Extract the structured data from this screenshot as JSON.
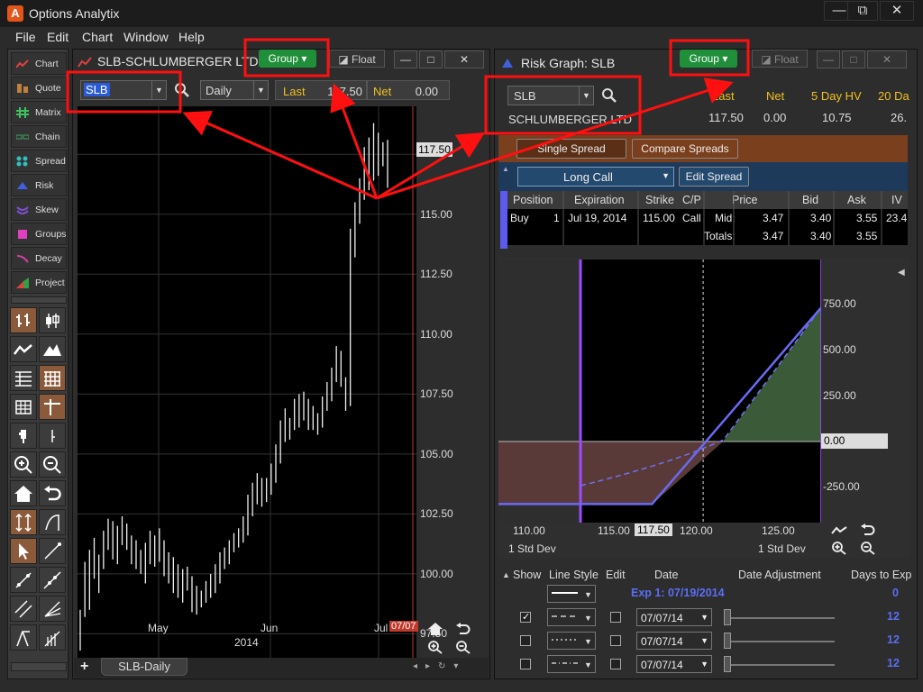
{
  "app": {
    "title": "Options Analytix",
    "logo": "A"
  },
  "window_controls": {
    "minimize": "—",
    "restore": "⧉",
    "close": "✕"
  },
  "menu": [
    "File",
    "Edit",
    "Chart",
    "Window",
    "Help"
  ],
  "sidebar": {
    "items": [
      {
        "label": "Chart",
        "icon": "chart-line-icon"
      },
      {
        "label": "Quote",
        "icon": "quote-icon"
      },
      {
        "label": "Matrix",
        "icon": "matrix-icon"
      },
      {
        "label": "Chain",
        "icon": "chain-icon"
      },
      {
        "label": "Spread",
        "icon": "spread-icon"
      },
      {
        "label": "Risk",
        "icon": "risk-icon"
      },
      {
        "label": "Skew",
        "icon": "skew-icon"
      },
      {
        "label": "Groups",
        "icon": "groups-icon"
      },
      {
        "label": "Decay",
        "icon": "decay-icon"
      },
      {
        "label": "Project",
        "icon": "project-icon"
      }
    ]
  },
  "chart_panel": {
    "title": "SLB-SCHLUMBERGER LTD",
    "group_label": "Group",
    "float_label": "Float",
    "symbol": "SLB",
    "interval": "Daily",
    "last_label": "Last",
    "last_value": "117.50",
    "net_label": "Net",
    "net_value": "0.00",
    "price_badge": "117.50",
    "date_badge": "07/07",
    "x_labels": [
      "May",
      "Jun",
      "Jul"
    ],
    "year_label": "2014",
    "tab_label": "SLB-Daily",
    "add_tab": "+"
  },
  "chart_data": {
    "type": "ohlc",
    "title": "SLB-SCHLUMBERGER LTD",
    "y_ticks": [
      117.5,
      115.0,
      112.5,
      110.0,
      107.5,
      105.0,
      102.5,
      100.0,
      97.5
    ],
    "y_tick_labels": [
      "117.50",
      "115.00",
      "112.50",
      "110.00",
      "107.50",
      "105.00",
      "102.50",
      "100.00",
      "97.50"
    ],
    "ylim": [
      96.5,
      119.5
    ],
    "x_labels": [
      "May",
      "Jun",
      "Jul"
    ],
    "series": [
      {
        "values": [
          [
            98.5,
            96.8
          ],
          [
            100.5,
            98.2
          ],
          [
            101.0,
            98.5
          ],
          [
            101.5,
            99.8
          ],
          [
            100.8,
            99.2
          ],
          [
            101.8,
            100.2
          ],
          [
            102.3,
            101.0
          ],
          [
            102.2,
            100.6
          ],
          [
            102.0,
            100.4
          ],
          [
            102.4,
            101.2
          ],
          [
            102.1,
            101.0
          ],
          [
            101.6,
            100.4
          ],
          [
            101.4,
            100.2
          ],
          [
            101.0,
            100.0
          ],
          [
            101.3,
            99.6
          ],
          [
            101.8,
            100.4
          ],
          [
            101.6,
            100.3
          ],
          [
            101.9,
            100.5
          ],
          [
            101.4,
            99.9
          ],
          [
            100.9,
            99.6
          ],
          [
            100.7,
            99.2
          ],
          [
            100.4,
            99.0
          ],
          [
            100.2,
            98.8
          ],
          [
            100.3,
            99.3
          ],
          [
            99.9,
            98.4
          ],
          [
            99.5,
            98.3
          ],
          [
            99.3,
            98.6
          ],
          [
            99.7,
            98.8
          ],
          [
            100.0,
            99.0
          ],
          [
            100.4,
            99.2
          ],
          [
            100.9,
            99.6
          ],
          [
            101.1,
            100.2
          ],
          [
            101.4,
            100.4
          ],
          [
            101.7,
            100.9
          ],
          [
            101.9,
            101.1
          ],
          [
            102.4,
            101.3
          ],
          [
            103.3,
            101.6
          ],
          [
            103.8,
            102.4
          ],
          [
            104.2,
            102.9
          ],
          [
            104.0,
            102.8
          ],
          [
            104.0,
            103.0
          ],
          [
            104.6,
            103.3
          ],
          [
            105.4,
            103.8
          ],
          [
            106.4,
            104.6
          ],
          [
            106.9,
            105.5
          ],
          [
            106.5,
            105.6
          ],
          [
            107.3,
            106.0
          ],
          [
            107.5,
            106.1
          ],
          [
            107.6,
            106.4
          ],
          [
            107.3,
            106.0
          ],
          [
            107.0,
            106.0
          ],
          [
            106.7,
            105.8
          ],
          [
            107.4,
            106.1
          ],
          [
            108.0,
            106.8
          ],
          [
            108.6,
            107.2
          ],
          [
            109.5,
            108.0
          ],
          [
            109.3,
            107.8
          ],
          [
            108.2,
            106.8
          ],
          [
            114.4,
            107.0
          ],
          [
            115.5,
            113.2
          ],
          [
            116.5,
            114.6
          ],
          [
            117.8,
            115.6
          ],
          [
            118.2,
            116.0
          ],
          [
            118.8,
            116.4
          ],
          [
            118.4,
            116.6
          ],
          [
            118.0,
            117.0
          ],
          [
            118.1,
            116.1
          ]
        ]
      }
    ],
    "grid": true
  },
  "risk_panel": {
    "title": "Risk Graph: SLB",
    "group_label": "Group",
    "float_label": "Float",
    "symbol": "SLB",
    "company": "SCHLUMBERGER LTD",
    "stats_headers": [
      "Last",
      "Net",
      "5 Day HV",
      "20 Da"
    ],
    "stats_values": [
      "117.50",
      "0.00",
      "10.75",
      "26."
    ],
    "single_spread": "Single Spread",
    "compare_spreads": "Compare Spreads",
    "strategy": "Long Call",
    "edit_spread": "Edit Spread",
    "table": {
      "headers": [
        "Position",
        "Expiration",
        "Strike",
        "C/P",
        "Price",
        "Bid",
        "Ask",
        "IV"
      ],
      "row": {
        "action": "Buy",
        "qty": "1",
        "expiration": "Jul 19, 2014",
        "strike": "115.00",
        "cp": "Call",
        "price_label": "Mid:",
        "price": "3.47",
        "bid": "3.40",
        "ask": "3.55",
        "iv": "23.4"
      },
      "totals_label": "Totals:",
      "totals": {
        "price": "3.47",
        "bid": "3.40",
        "ask": "3.55"
      }
    }
  },
  "risk_graph": {
    "y_labels": [
      "750.00",
      "500.00",
      "250.00",
      "0.00",
      "-250.00"
    ],
    "x_labels": [
      "110.00",
      "115.00",
      "117.50",
      "120.00",
      "125.00"
    ],
    "std_dev_left": "1 Std Dev",
    "std_dev_right": "1 Std Dev"
  },
  "controls": {
    "headers": [
      "Show",
      "Line Style",
      "Edit",
      "Date",
      "Date Adjustment",
      "Days to Exp"
    ],
    "exp_label": "Exp 1: 07/19/2014",
    "exp_days": "0",
    "rows": [
      {
        "checked": true,
        "date": "07/07/14",
        "days": "12"
      },
      {
        "checked": false,
        "date": "07/07/14",
        "days": "12"
      },
      {
        "checked": false,
        "date": "07/07/14",
        "days": "12"
      }
    ]
  }
}
